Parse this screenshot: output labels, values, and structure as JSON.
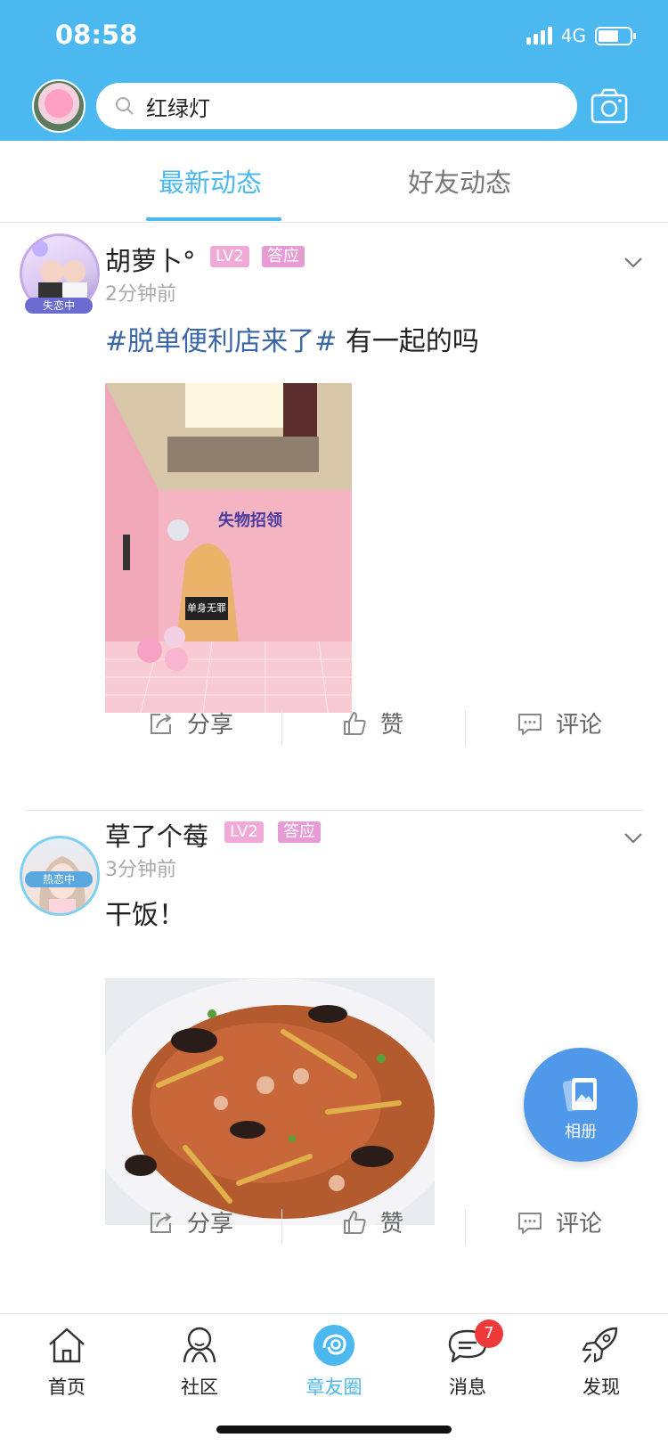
{
  "status_bar": {
    "time": "08:58",
    "network": "4G"
  },
  "header": {
    "search_value": "红绿灯"
  },
  "tabs": [
    {
      "label": "最新动态",
      "active": true
    },
    {
      "label": "好友动态",
      "active": false
    }
  ],
  "posts": [
    {
      "avatar_tag": "失恋中",
      "name": "胡萝卜°",
      "level": "LV2",
      "badge": "答应",
      "time": "2分钟前",
      "hashtag": "#脱单便利店来了#",
      "text": " 有一起的吗",
      "photo": {
        "signboard": "失物招领",
        "overlay_text": "单身无罪"
      }
    },
    {
      "avatar_tag": "热恋中",
      "name": "草了个莓",
      "level": "LV2",
      "badge": "答应",
      "time": "3分钟前",
      "hashtag": "",
      "text": "干饭！"
    }
  ],
  "actions": {
    "share": "分享",
    "like": "赞",
    "comment": "评论"
  },
  "floating_button": {
    "label": "相册"
  },
  "nav": [
    {
      "label": "首页",
      "icon": "home-icon"
    },
    {
      "label": "社区",
      "icon": "community-icon"
    },
    {
      "label": "章友圈",
      "icon": "circle-icon",
      "active": true
    },
    {
      "label": "消息",
      "icon": "message-icon",
      "badge": "7"
    },
    {
      "label": "发现",
      "icon": "rocket-icon"
    }
  ],
  "colors": {
    "accent": "#4cb8f0",
    "hashtag": "#3a66a8",
    "badge_red": "#ee3a3a"
  }
}
